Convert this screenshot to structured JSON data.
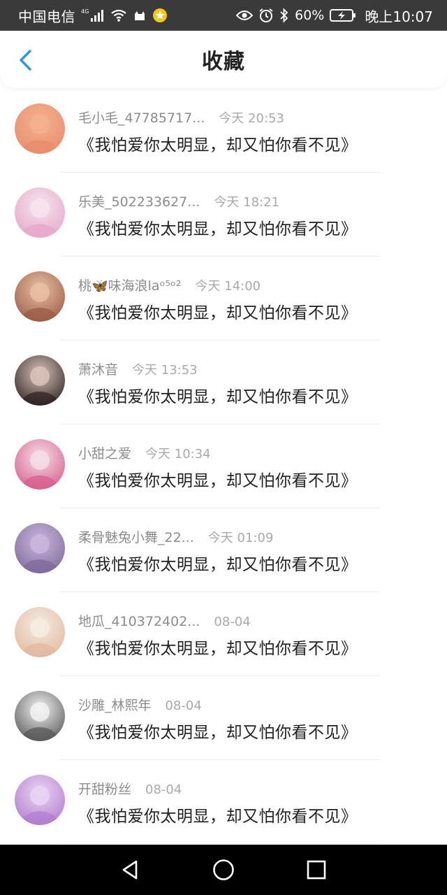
{
  "status_bar": {
    "carrier": "中国电信",
    "network": "4G",
    "battery": "60%",
    "time": "晚上10:07",
    "icons": [
      "signal-icon",
      "wifi-icon",
      "cat-icon",
      "star-icon",
      "eye-icon",
      "alarm-icon",
      "bluetooth-icon",
      "battery-icon"
    ]
  },
  "header": {
    "title": "收藏",
    "back_icon": "chevron-left-icon"
  },
  "items": [
    {
      "username": "毛小毛_47785717...",
      "time": "今天 20:53",
      "content": "《我怕爱你太明显，却又怕你看不见》",
      "avatar_colors": [
        "#f4b18e",
        "#e88c6c"
      ]
    },
    {
      "username": "乐美_502233627...",
      "time": "今天 18:21",
      "content": "《我怕爱你太明显，却又怕你看不见》",
      "avatar_colors": [
        "#f6e4ef",
        "#e6a6c8"
      ]
    },
    {
      "username": "桃🦋味海浪laᵒ⁵ᵒ²",
      "time": "今天 14:00",
      "content": "《我怕爱你太明显，却又怕你看不见》",
      "avatar_colors": [
        "#e8c0a4",
        "#9a5a44"
      ]
    },
    {
      "username": "萧沐音",
      "time": "今天 13:53",
      "content": "《我怕爱你太明显，却又怕你看不见》",
      "avatar_colors": [
        "#d9c2b8",
        "#2b2020"
      ]
    },
    {
      "username": "小甜之爱",
      "time": "今天 10:34",
      "content": "《我怕爱你太明显，却又怕你看不见》",
      "avatar_colors": [
        "#f5dde6",
        "#d65c8c"
      ]
    },
    {
      "username": "柔骨魅兔小舞_22...",
      "time": "今天 01:09",
      "content": "《我怕爱你太明显，却又怕你看不见》",
      "avatar_colors": [
        "#c9b6dd",
        "#7e6a9a"
      ]
    },
    {
      "username": "地瓜_410372402...",
      "time": "08-04",
      "content": "《我怕爱你太明显，却又怕你看不见》",
      "avatar_colors": [
        "#f6ece2",
        "#e0b89c"
      ]
    },
    {
      "username": "沙雕_林熙年",
      "time": "08-04",
      "content": "《我怕爱你太明显，却又怕你看不见》",
      "avatar_colors": [
        "#f2f2f2",
        "#555555"
      ]
    },
    {
      "username": "开甜粉丝",
      "time": "08-04",
      "content": "《我怕爱你太明显，却又怕你看不见》",
      "avatar_colors": [
        "#e9d4f2",
        "#b27ad0"
      ]
    }
  ],
  "nav_bar": {
    "icons": [
      "back-triangle-icon",
      "home-circle-icon",
      "recents-square-icon"
    ]
  }
}
